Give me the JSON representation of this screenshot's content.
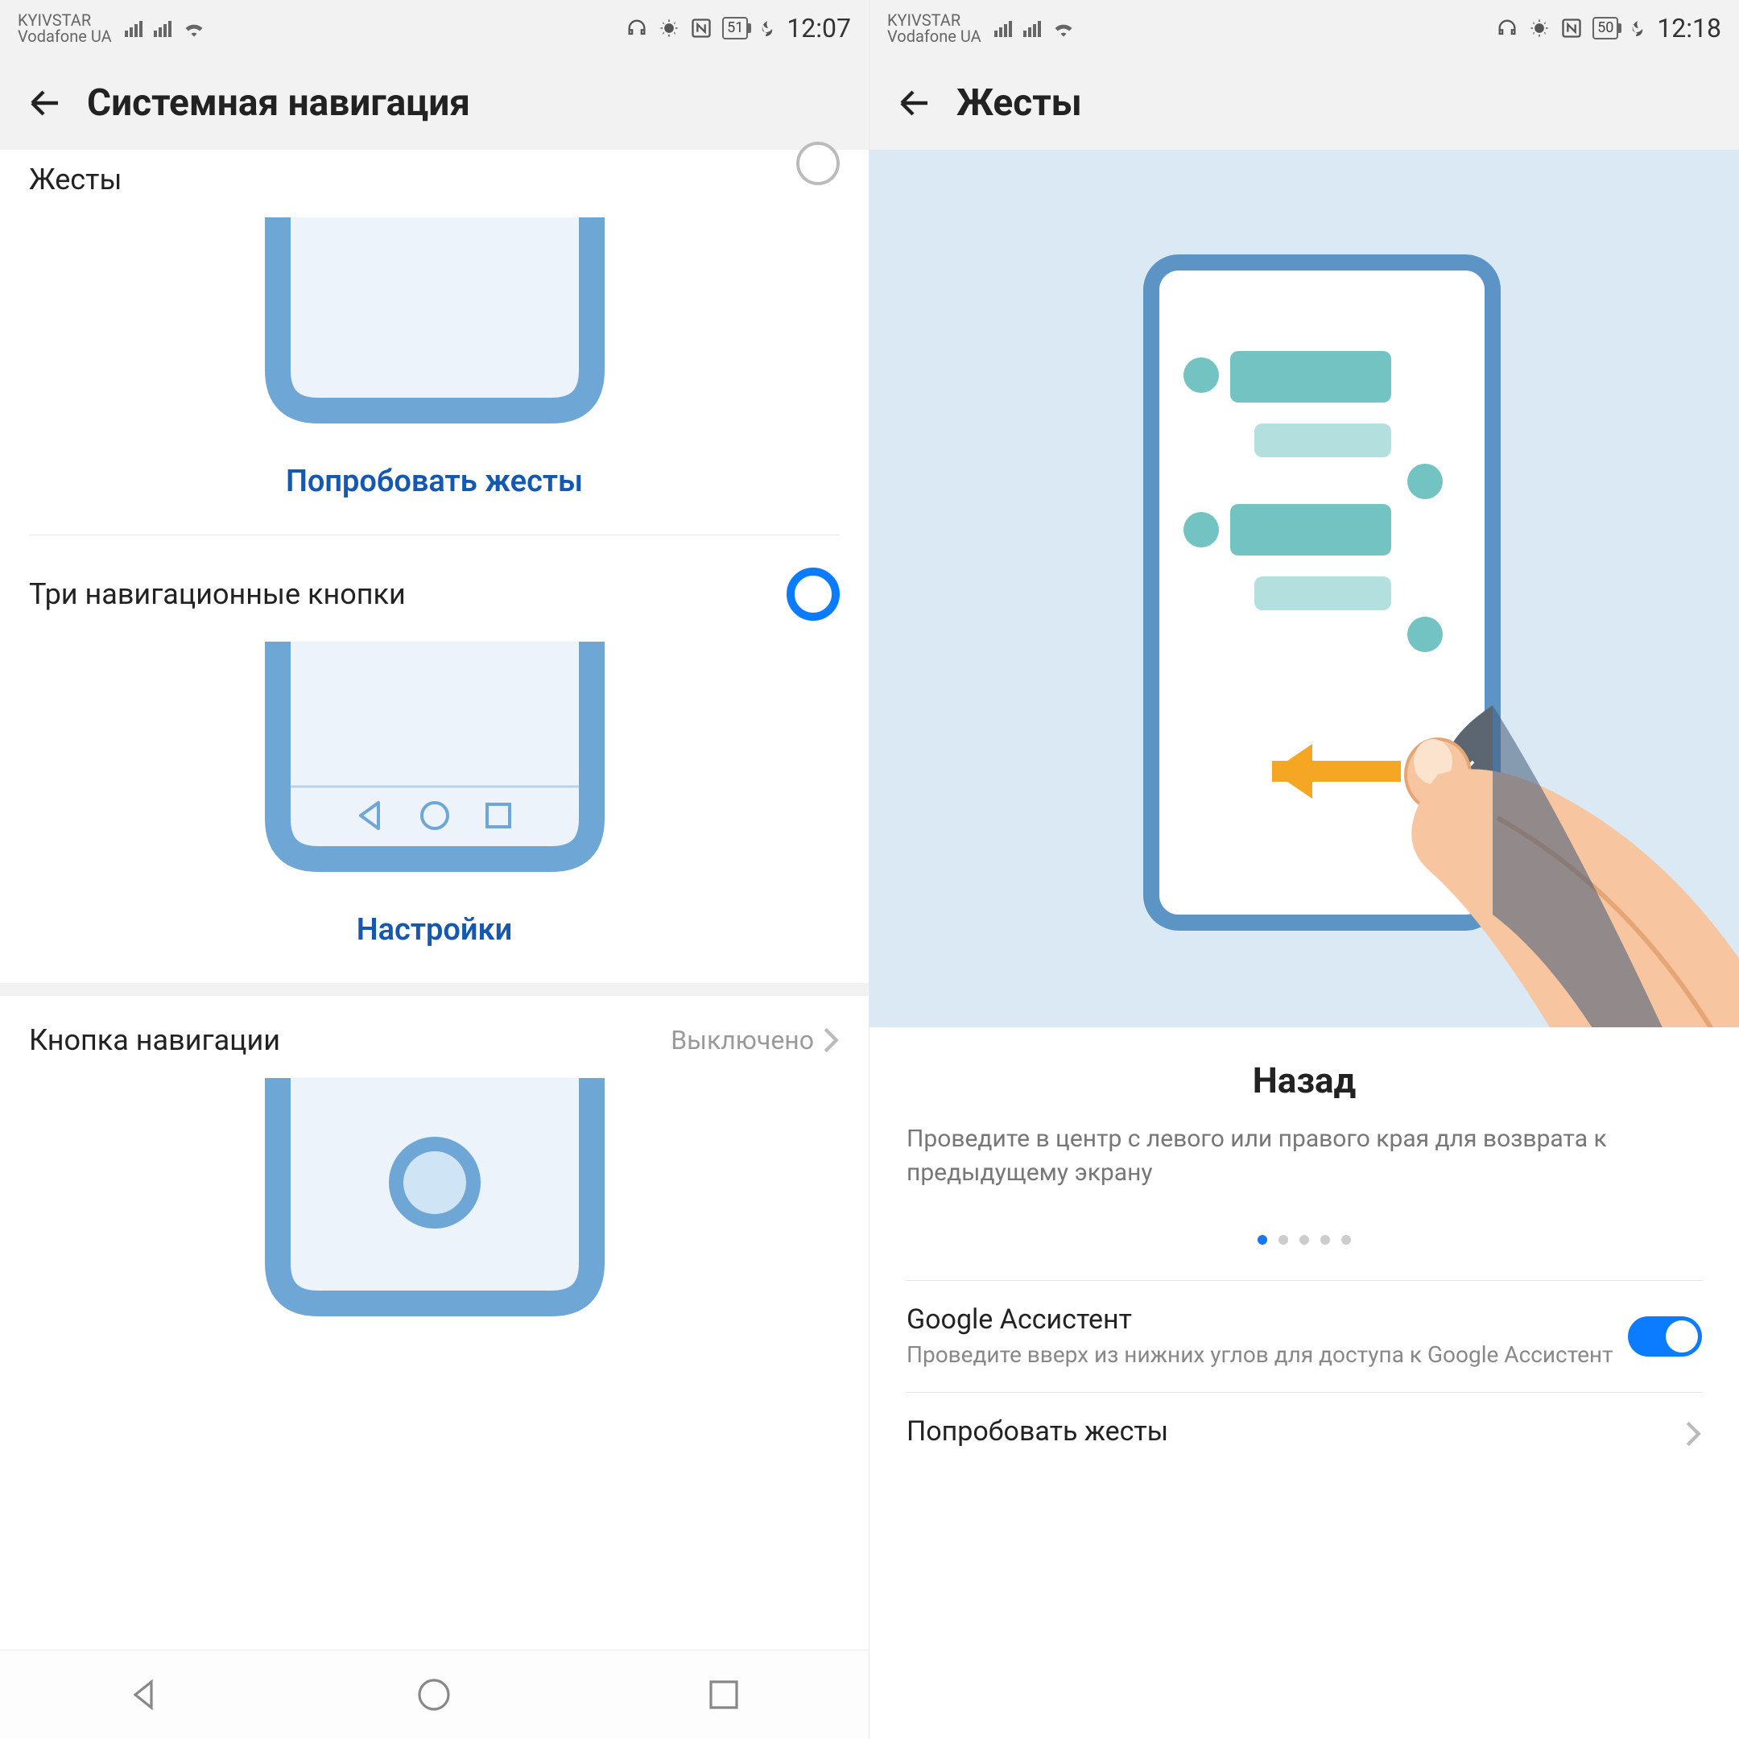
{
  "left": {
    "status": {
      "carrier1": "KYIVSTAR",
      "carrier2": "Vodafone UA",
      "battery": "51",
      "time": "12:07"
    },
    "header_title": "Системная навигация",
    "opt_gestures": "Жесты",
    "try_gestures": "Попробовать жесты",
    "opt_three": "Три навигационные кнопки",
    "settings_link": "Настройки",
    "opt_navbtn": "Кнопка навигации",
    "opt_navbtn_val": "Выключено"
  },
  "right": {
    "status": {
      "carrier1": "KYIVSTAR",
      "carrier2": "Vodafone UA",
      "battery": "50",
      "time": "12:18"
    },
    "header_title": "Жесты",
    "slide_title": "Назад",
    "slide_desc": "Проведите в центр с левого или правого края для возврата к предыдущему экрану",
    "ga_title": "Google Ассистент",
    "ga_desc": "Проведите вверх из нижних углов для доступа к Google Ассистент",
    "try_gestures": "Попробовать жесты"
  }
}
